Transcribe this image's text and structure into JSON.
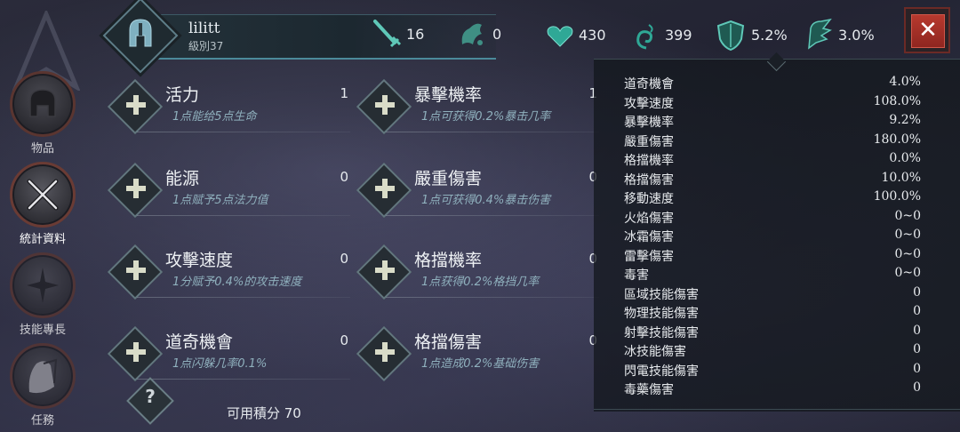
{
  "nav": [
    {
      "label": "物品",
      "icon": "helmet-icon",
      "active": false
    },
    {
      "label": "統計資料",
      "icon": "crossed-swords-icon",
      "active": true
    },
    {
      "label": "技能專長",
      "icon": "skill-tree-icon",
      "active": false
    },
    {
      "label": "任務",
      "icon": "quest-scroll-icon",
      "active": false
    }
  ],
  "player": {
    "name": "lilitt",
    "level": "級別37",
    "resource_a": "16",
    "resource_b": "0"
  },
  "top_stats": {
    "health": "430",
    "mana": "399",
    "stat_shield": "5.2%",
    "stat_wing": "3.0%"
  },
  "close_label": "✕",
  "attributes": [
    {
      "name": "活力",
      "value": "1",
      "desc": "1点能给5点生命"
    },
    {
      "name": "暴擊機率",
      "value": "1",
      "desc": "1点可获得0.2%暴击几率"
    },
    {
      "name": "能源",
      "value": "0",
      "desc": "1点赋予5点法力值"
    },
    {
      "name": "嚴重傷害",
      "value": "0",
      "desc": "1点可获得0.4%暴击伤害"
    },
    {
      "name": "攻擊速度",
      "value": "0",
      "desc": "1分赋予0.4%的攻击速度"
    },
    {
      "name": "格擋機率",
      "value": "0",
      "desc": "1点获得0.2%格挡几率"
    },
    {
      "name": "道奇機會",
      "value": "0",
      "desc": "1点闪躲几率0.1%"
    },
    {
      "name": "格擋傷害",
      "value": "0",
      "desc": "1点造成0.2%基础伤害"
    }
  ],
  "help_label": "?",
  "available_points": "可用積分 70",
  "stats": [
    {
      "k": "道奇機會",
      "v": "4.0%"
    },
    {
      "k": "攻擊速度",
      "v": "108.0%"
    },
    {
      "k": "暴擊機率",
      "v": "9.2%"
    },
    {
      "k": "嚴重傷害",
      "v": "180.0%"
    },
    {
      "k": "格擋機率",
      "v": "0.0%"
    },
    {
      "k": "格擋傷害",
      "v": "10.0%"
    },
    {
      "k": "移動速度",
      "v": "100.0%"
    },
    {
      "k": "火焰傷害",
      "v": "0~0"
    },
    {
      "k": "冰霜傷害",
      "v": "0~0"
    },
    {
      "k": "雷擊傷害",
      "v": "0~0"
    },
    {
      "k": "毒害",
      "v": "0~0"
    },
    {
      "k": "區域技能傷害",
      "v": "0"
    },
    {
      "k": "物理技能傷害",
      "v": "0"
    },
    {
      "k": "射擊技能傷害",
      "v": "0"
    },
    {
      "k": "冰技能傷害",
      "v": "0"
    },
    {
      "k": "閃電技能傷害",
      "v": "0"
    },
    {
      "k": "毒藥傷害",
      "v": "0"
    }
  ]
}
